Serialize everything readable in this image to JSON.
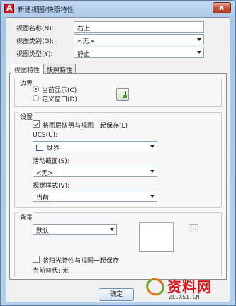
{
  "window": {
    "title": "新建视图/快照特性",
    "close_glyph": "x"
  },
  "fields": {
    "view_name_label": "视图名称(N):",
    "view_name_value": "右上",
    "view_category_label": "视图类别(G):",
    "view_category_value": "<无>",
    "view_type_label": "视图类型(Y):",
    "view_type_value": "静止"
  },
  "tabs": [
    {
      "label": "视图特性",
      "active": true
    },
    {
      "label": "快照特性",
      "active": false
    }
  ],
  "boundary": {
    "title": "边界",
    "options": [
      {
        "label": "当前显示(C)",
        "selected": true
      },
      {
        "label": "定义窗口(D)",
        "selected": false
      }
    ],
    "pick_icon": "define-window-icon"
  },
  "settings": {
    "title": "设置",
    "save_layer_snapshot": {
      "label": "将图层快照与视图一起保存(L)",
      "checked": true
    },
    "ucs_label": "UCS(U):",
    "ucs_value": "世界",
    "ucs_icon": "world-ucs-icon",
    "section_label": "活动截面(S):",
    "section_value": "<无>",
    "visual_style_label": "视觉样式(V):",
    "visual_style_value": "当前"
  },
  "background": {
    "title": "背景",
    "value": "默认",
    "ellipsis": "...",
    "save_sun": {
      "label": "将阳光特性与视图一起保存",
      "checked": false
    },
    "override_text": "当前替代: 无"
  },
  "buttons": {
    "ok": "确定"
  },
  "watermark": {
    "brand": "资料网",
    "url": "ZL.XS1.CN"
  },
  "colors": {
    "title_bar": "#aac6e6",
    "close_button": "#c8523c",
    "watermark_red": "#d8131a",
    "accent_orange": "#e2741a",
    "accent_green": "#6aa820"
  }
}
